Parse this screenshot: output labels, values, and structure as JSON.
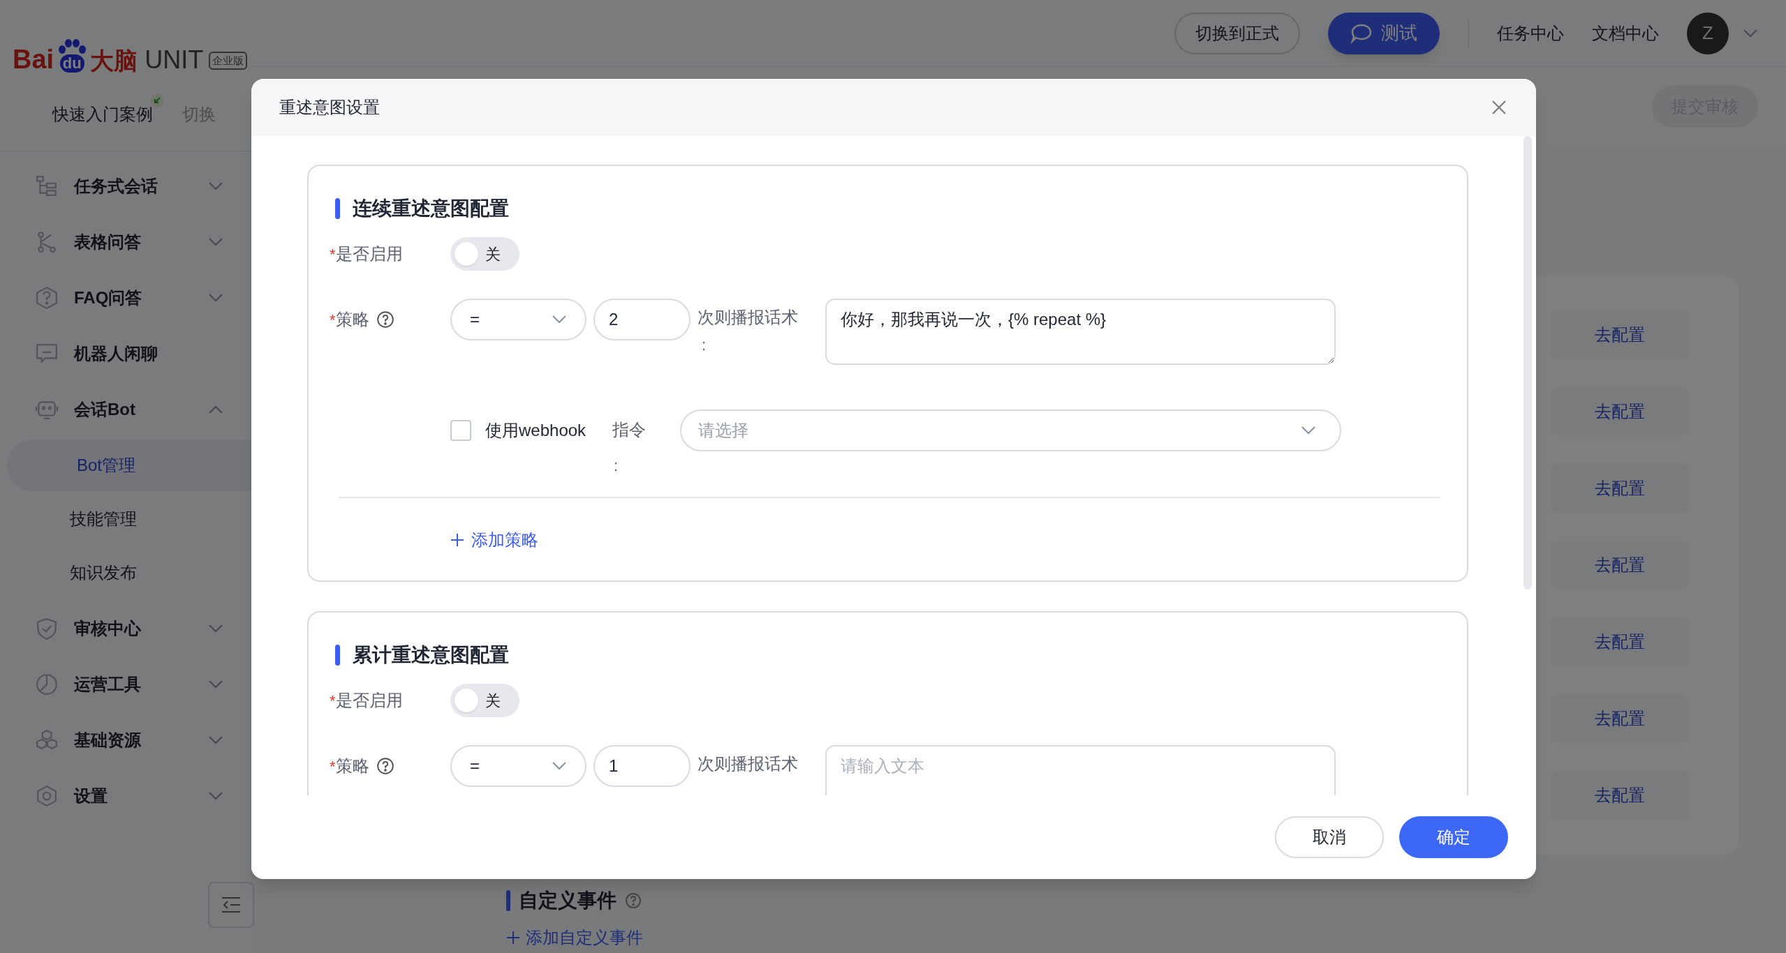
{
  "top_bar": {
    "buttons": [
      {
        "label": "切换到正式",
        "kind": "outline"
      },
      {
        "label": "测试",
        "kind": "primary"
      }
    ],
    "links": [
      "任务中心",
      "文档中心"
    ],
    "avatar": "Z"
  },
  "sidebar": {
    "logo": {
      "bai": "Bai",
      "du": "du",
      "brain": "大脑",
      "product": "UNIT",
      "edition": "企业版"
    },
    "project": "快速入门案例",
    "switch": "切换",
    "items": [
      {
        "label": "任务式会话",
        "expanded": false
      },
      {
        "label": "表格问答",
        "expanded": false
      },
      {
        "label": "FAQ问答",
        "expanded": false
      },
      {
        "label": "机器人闲聊"
      },
      {
        "label": "会话Bot",
        "expanded": true,
        "children": [
          {
            "label": "Bot管理",
            "selected": true
          },
          {
            "label": "技能管理",
            "selected": false
          },
          {
            "label": "知识发布",
            "selected": false
          }
        ]
      },
      {
        "label": "审核中心",
        "expanded": false
      },
      {
        "label": "运营工具",
        "expanded": false
      },
      {
        "label": "基础资源",
        "expanded": false
      },
      {
        "label": "设置",
        "expanded": false
      }
    ]
  },
  "main": {
    "submit": "提交审核",
    "config_links": [
      "去配置",
      "去配置",
      "去配置",
      "去配置",
      "去配置",
      "去配置",
      "去配置"
    ],
    "event_section": {
      "title": "自定义事件",
      "add": "添加自定义事件"
    }
  },
  "modal": {
    "title": "重述意图设置",
    "sections": [
      {
        "title": "连续重述意图配置",
        "enable_mark": "*",
        "strategy_mark": "*",
        "enable_label": "是否启用",
        "enabled": false,
        "toggle_label": "关",
        "strategy_label": "策略",
        "operator": "=",
        "count": "2",
        "reply_label": "次则播报话术",
        "reply_colon": ":",
        "reply_value": "你好，那我再说一次，{% repeat %}",
        "webhook": {
          "label": "使用webhook",
          "checked": false,
          "command_label": "指令",
          "command_colon": ":",
          "command_placeholder": "请选择"
        },
        "add": "添加策略"
      },
      {
        "title": "累计重述意图配置",
        "enable_mark": "*",
        "strategy_mark": "*",
        "enable_label": "是否启用",
        "enabled": false,
        "toggle_label": "关",
        "strategy_label": "策略",
        "operator": "=",
        "count": "1",
        "reply_label": "次则播报话术",
        "reply_placeholder": "请输入文本"
      }
    ],
    "buttons": [
      {
        "label": "取消",
        "kind": "secondary"
      },
      {
        "label": "确定",
        "kind": "primary"
      }
    ]
  }
}
